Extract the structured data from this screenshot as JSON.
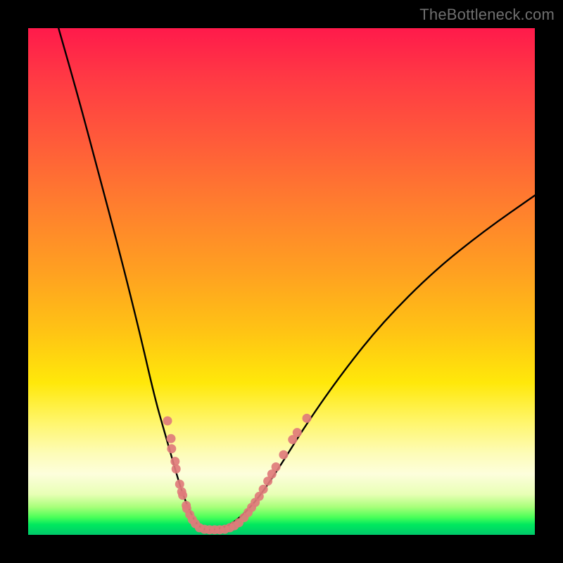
{
  "watermark": "TheBottleneck.com",
  "chart_data": {
    "type": "line",
    "title": "",
    "xlabel": "",
    "ylabel": "",
    "xlim": [
      0,
      100
    ],
    "ylim": [
      0,
      100
    ],
    "grid": false,
    "series": [
      {
        "name": "curve",
        "color": "#000000",
        "x": [
          6,
          10,
          14,
          18,
          22,
          25,
          27,
          29,
          30.5,
          32,
          33,
          34,
          35,
          37,
          40,
          43,
          46,
          50,
          55,
          62,
          70,
          80,
          90,
          100
        ],
        "y": [
          100,
          86,
          71,
          56,
          40,
          27,
          20,
          13,
          8,
          4.5,
          2.5,
          1.5,
          1,
          1,
          2,
          4.5,
          8,
          14,
          22,
          32,
          42,
          52,
          60,
          67
        ]
      }
    ],
    "marker_clusters": [
      {
        "name": "left-descent-markers",
        "color": "#e07b7b",
        "points": [
          {
            "x": 27.5,
            "y": 22.5
          },
          {
            "x": 28.2,
            "y": 19.0
          },
          {
            "x": 28.3,
            "y": 17.0
          },
          {
            "x": 29.0,
            "y": 14.5
          },
          {
            "x": 29.2,
            "y": 13.0
          },
          {
            "x": 29.9,
            "y": 10.0
          },
          {
            "x": 30.3,
            "y": 8.5
          },
          {
            "x": 30.5,
            "y": 7.8
          },
          {
            "x": 31.2,
            "y": 5.8
          },
          {
            "x": 31.3,
            "y": 5.2
          },
          {
            "x": 31.9,
            "y": 4.0
          },
          {
            "x": 32.4,
            "y": 3.0
          },
          {
            "x": 33.0,
            "y": 2.2
          }
        ]
      },
      {
        "name": "bottom-valley-markers",
        "color": "#e07b7b",
        "points": [
          {
            "x": 33.8,
            "y": 1.4
          },
          {
            "x": 34.8,
            "y": 1.1
          },
          {
            "x": 35.8,
            "y": 1.0
          },
          {
            "x": 36.8,
            "y": 1.0
          },
          {
            "x": 37.8,
            "y": 1.0
          },
          {
            "x": 38.8,
            "y": 1.1
          },
          {
            "x": 39.8,
            "y": 1.4
          },
          {
            "x": 40.7,
            "y": 1.8
          },
          {
            "x": 41.6,
            "y": 2.4
          }
        ]
      },
      {
        "name": "right-ascent-markers",
        "color": "#e07b7b",
        "points": [
          {
            "x": 42.6,
            "y": 3.4
          },
          {
            "x": 43.4,
            "y": 4.4
          },
          {
            "x": 44.1,
            "y": 5.4
          },
          {
            "x": 44.8,
            "y": 6.4
          },
          {
            "x": 45.6,
            "y": 7.6
          },
          {
            "x": 46.4,
            "y": 9.0
          },
          {
            "x": 47.3,
            "y": 10.6
          },
          {
            "x": 48.1,
            "y": 12.0
          },
          {
            "x": 48.9,
            "y": 13.4
          },
          {
            "x": 50.4,
            "y": 15.8
          },
          {
            "x": 52.2,
            "y": 18.8
          },
          {
            "x": 53.1,
            "y": 20.2
          },
          {
            "x": 55.0,
            "y": 23.0
          }
        ]
      }
    ]
  }
}
